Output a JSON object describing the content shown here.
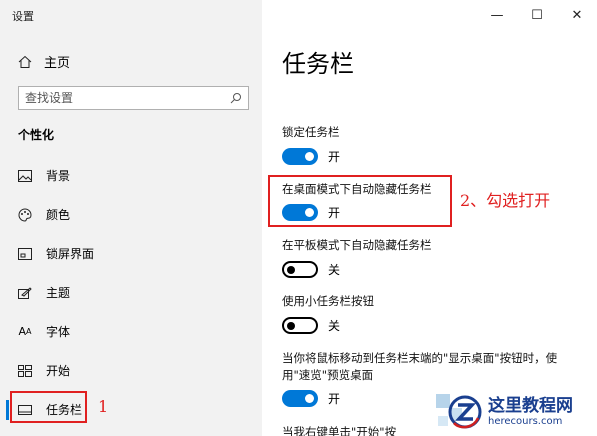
{
  "window": {
    "title": "设置",
    "minimize": "—",
    "maximize": "☐",
    "close": "✕"
  },
  "sidebar": {
    "home_label": "主页",
    "search_placeholder": "查找设置",
    "section_title": "个性化",
    "items": [
      {
        "label": "背景",
        "icon": "image-icon"
      },
      {
        "label": "颜色",
        "icon": "palette-icon"
      },
      {
        "label": "锁屏界面",
        "icon": "lock-screen-icon"
      },
      {
        "label": "主题",
        "icon": "theme-icon"
      },
      {
        "label": "字体",
        "icon": "font-icon"
      },
      {
        "label": "开始",
        "icon": "start-icon"
      },
      {
        "label": "任务栏",
        "icon": "taskbar-icon",
        "active": true
      }
    ]
  },
  "main": {
    "title": "任务栏",
    "settings": [
      {
        "label": "锁定任务栏",
        "state": "开"
      },
      {
        "label": "在桌面模式下自动隐藏任务栏",
        "state": "开"
      },
      {
        "label": "在平板模式下自动隐藏任务栏",
        "state": "关"
      },
      {
        "label": "使用小任务栏按钮",
        "state": "关"
      },
      {
        "label_line1": "当你将鼠标移动到任务栏末端的\"显示桌面\"按钮时，使",
        "label_line2": "用\"速览\"预览桌面",
        "state": "开"
      },
      {
        "label": "当我右键单击\"开始\"按"
      }
    ]
  },
  "annotations": {
    "step1": "1",
    "step2": "2、勾选打开"
  },
  "watermark": {
    "name": "这里教程网",
    "url": "herecours.com"
  },
  "colors": {
    "accent": "#0078d7",
    "annotation": "#e02020",
    "watermark": "#1a3f8f"
  }
}
